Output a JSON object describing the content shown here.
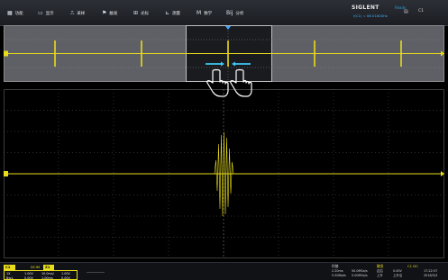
{
  "menu": {
    "items": [
      {
        "icon": "▦",
        "label": "功能"
      },
      {
        "icon": "▭",
        "label": "显示"
      },
      {
        "icon": "⎍",
        "label": "采样"
      },
      {
        "icon": "⚑",
        "label": "触发"
      },
      {
        "icon": "⊞",
        "label": "光标"
      },
      {
        "icon": "⊾",
        "label": "测量"
      },
      {
        "icon": "M",
        "label": "数学"
      },
      {
        "icon": "Bij",
        "label": "分析"
      }
    ]
  },
  "header": {
    "brand": "SIGLENT",
    "status": "Ready",
    "trigger_readout": "f(C1) = 66.01800Hz",
    "channel_indicator": "C1"
  },
  "gestures": {
    "icon_names": [
      "hand-pointer-icon",
      "hand-pointer-icon"
    ],
    "arrow_color": "#3fc8f5"
  },
  "waveform": {
    "channel_color": "#e8dc1c",
    "ground_marker_color": "#e8dc1c"
  },
  "bottom": {
    "c1_tag": "C1",
    "coupling_tag": "DCIM",
    "zoom_tag": "Z1",
    "c1_values": [
      [
        "1X",
        "1.00V",
        "10.0ms/",
        "1.00V"
      ],
      [
        "Bw:L",
        "0.00V",
        "1.00ms",
        "0.00V"
      ]
    ],
    "timebase_header": "时基",
    "timebase_values": [
      "2.20ms",
      "5.50Mpts"
    ],
    "sample_values": [
      "50.0MSa/s",
      "5.00MSa/s"
    ],
    "trigger_header": "触发",
    "trigger_labels": [
      "边沿",
      "上升"
    ],
    "trigger_values": [
      "0.00V",
      "上升沿"
    ],
    "coupling_header": "C1 DC",
    "time_display": "17:22:37",
    "date_display": "2018/3/3"
  }
}
